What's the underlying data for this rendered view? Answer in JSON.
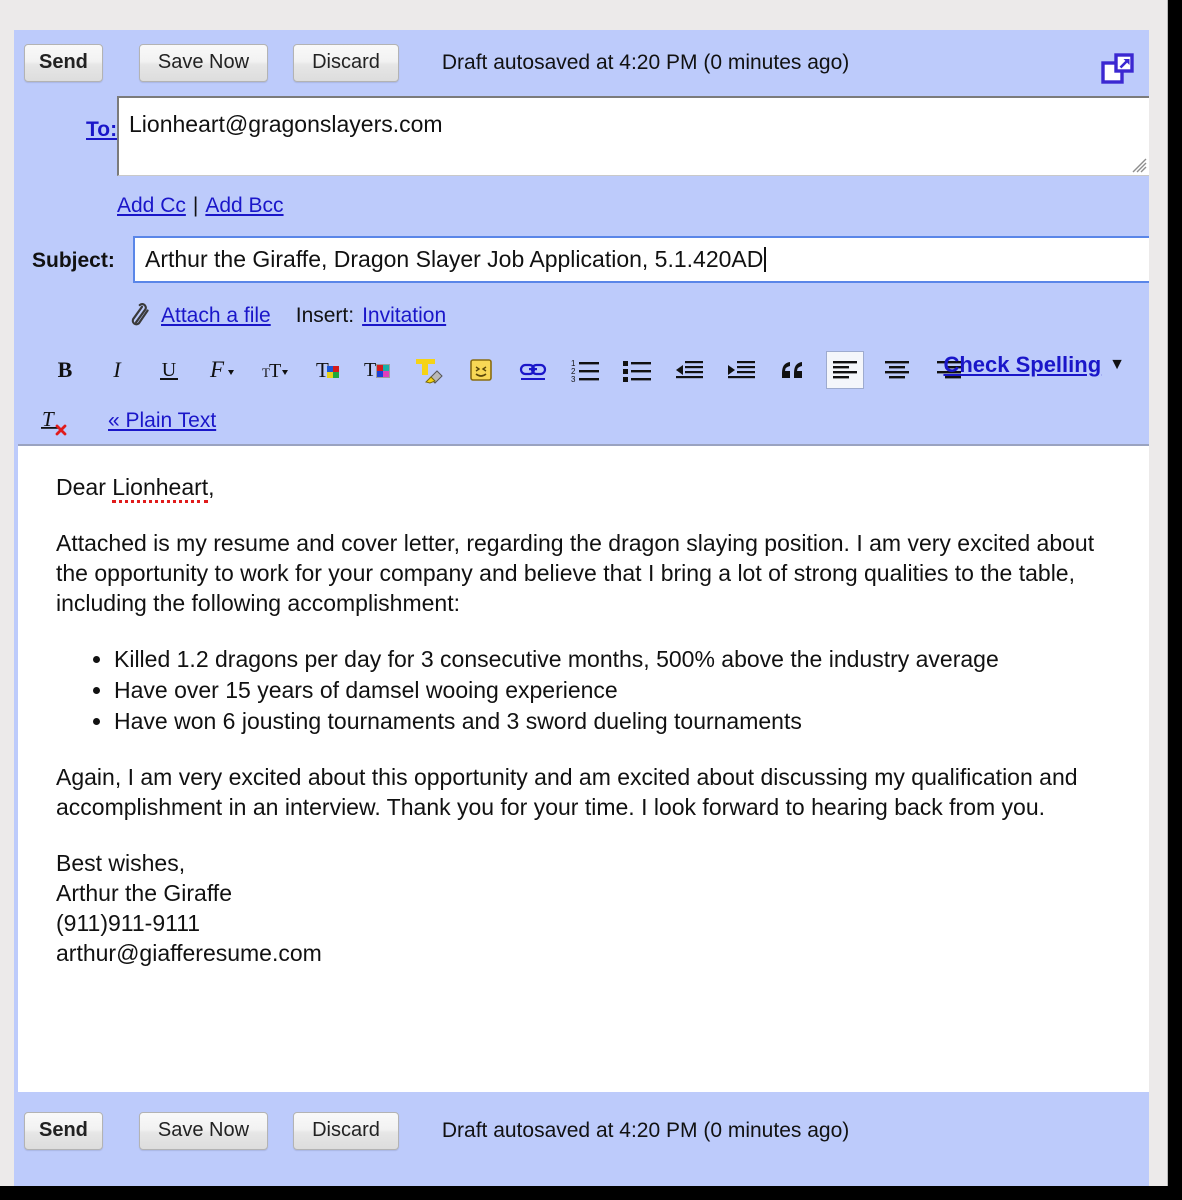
{
  "window": {
    "popout_icon": "popout-new-window-icon"
  },
  "toolbar_top": {
    "send_label": "Send",
    "save_label": "Save Now",
    "discard_label": "Discard",
    "autosave_status": "Draft autosaved at 4:20 PM (0 minutes ago)"
  },
  "toolbar_bottom": {
    "send_label": "Send",
    "save_label": "Save Now",
    "discard_label": "Discard",
    "autosave_status": "Draft autosaved at 4:20 PM (0 minutes ago)"
  },
  "fields": {
    "to_label": "To:",
    "to_value": "Lionheart@gragonslayers.com",
    "add_cc_label": "Add Cc",
    "field_separator": "|",
    "add_bcc_label": "Add Bcc",
    "subject_label": "Subject:",
    "subject_value": "Arthur the Giraffe, Dragon Slayer Job Application, 5.1.420AD"
  },
  "attach": {
    "attach_label": "Attach a file",
    "insert_label": "Insert:",
    "invitation_label": "Invitation"
  },
  "format_toolbar": {
    "items": [
      {
        "name": "bold-icon",
        "title": "Bold"
      },
      {
        "name": "italic-icon",
        "title": "Italic"
      },
      {
        "name": "underline-icon",
        "title": "Underline"
      },
      {
        "name": "font-family-icon",
        "title": "Font"
      },
      {
        "name": "font-size-icon",
        "title": "Size"
      },
      {
        "name": "text-color-icon",
        "title": "Text color"
      },
      {
        "name": "text-background-color-icon",
        "title": "Text background color"
      },
      {
        "name": "highlight-icon",
        "title": "Highlight color"
      },
      {
        "name": "emoji-icon",
        "title": "Insert emoticon"
      },
      {
        "name": "link-icon",
        "title": "Link"
      },
      {
        "name": "numbered-list-icon",
        "title": "Numbered list"
      },
      {
        "name": "bulleted-list-icon",
        "title": "Bulleted list"
      },
      {
        "name": "outdent-icon",
        "title": "Indent less"
      },
      {
        "name": "indent-icon",
        "title": "Indent more"
      },
      {
        "name": "quote-icon",
        "title": "Quote"
      },
      {
        "name": "align-left-icon",
        "title": "Align left"
      },
      {
        "name": "align-center-icon",
        "title": "Align center"
      },
      {
        "name": "align-right-icon",
        "title": "Align right"
      }
    ],
    "active_item": "align-left-icon",
    "check_spelling_label": "Check Spelling",
    "check_spelling_arrow": "▼",
    "remove_formatting_icon": "remove-formatting-icon",
    "plain_text_label": "« Plain Text"
  },
  "body": {
    "greeting_prefix": "Dear ",
    "greeting_name": "Lionheart",
    "greeting_suffix": ",",
    "paragraph_1": "Attached is my resume and cover letter, regarding the dragon slaying position.  I am very excited about the opportunity to work for your company and believe that I bring a lot of strong qualities to the table, including the following accomplishment:",
    "bullets": [
      "Killed 1.2 dragons per day for 3 consecutive months, 500% above the industry average",
      "Have over 15 years of damsel wooing experience",
      "Have won 6 jousting tournaments and 3 sword dueling tournaments"
    ],
    "paragraph_2": "Again, I am very excited about this opportunity and am excited about discussing my qualification and accomplishment in an interview.  Thank you for your time.  I look forward to hearing back from you.",
    "signature": {
      "closing": "Best wishes,",
      "name": "Arthur the Giraffe",
      "phone": "(911)911-9111",
      "email": "arthur@giafferesume.com"
    }
  },
  "colors": {
    "panel_background": "#bdcbfb",
    "link_blue": "#1a16c9",
    "focus_border": "#5a86e8",
    "spellcheck_red": "#e01b1b",
    "body_background": "#ffffff"
  }
}
